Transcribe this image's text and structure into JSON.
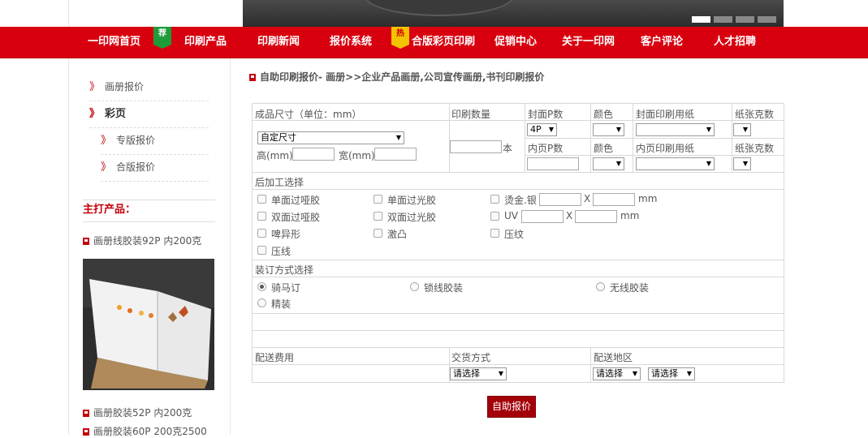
{
  "nav": {
    "items": [
      "一印网首页",
      "印刷产品",
      "印刷新闻",
      "报价系统",
      "合版彩页印刷",
      "促销中心",
      "关于一印网",
      "客户评论",
      "人才招聘"
    ],
    "badge_recommend": "荐",
    "badge_hot": "热"
  },
  "sidebar": {
    "items": [
      "画册报价",
      "彩页",
      "专版报价",
      "合版报价"
    ],
    "chevron": "》",
    "products_heading": "主打产品：",
    "products": [
      "画册线胶装92P 内200克",
      "画册胶装52P 内200克",
      "画册胶装60P 200克2500"
    ]
  },
  "breadcrumb": "自助印刷报价- 画册>>企业产品画册,公司宣传画册,书刊印刷报价",
  "form": {
    "size_label": "成品尺寸（单位：mm）",
    "size_select": "自定尺寸",
    "height_label": "高(mm)",
    "width_label": "宽(mm)",
    "qty_label": "印刷数量",
    "qty_unit": "本",
    "cover_pages_label": "封面P数",
    "cover_pages_value": "4P",
    "color_label": "颜色",
    "cover_paper_label": "封面印刷用纸",
    "paper_weight_label": "纸张克数",
    "inner_pages_label": "内页P数",
    "inner_paper_label": "内页印刷用纸",
    "postpress_label": "后加工选择",
    "postpress_options": [
      "单面过哑胶",
      "单面过光胶",
      "烫金.银",
      "双面过哑胶",
      "双面过光胶",
      "UV",
      "啤异形",
      "激凸",
      "压纹",
      "压线"
    ],
    "times": "X",
    "mm": "mm",
    "binding_label": "装订方式选择",
    "binding_options": [
      "骑马订",
      "锁线胶装",
      "无线胶装",
      "精装"
    ],
    "binding_selected": "骑马订",
    "shipping_fee_label": "配送费用",
    "delivery_method_label": "交货方式",
    "delivery_area_label": "配送地区",
    "please_select": "请选择",
    "submit": "自助报价"
  }
}
